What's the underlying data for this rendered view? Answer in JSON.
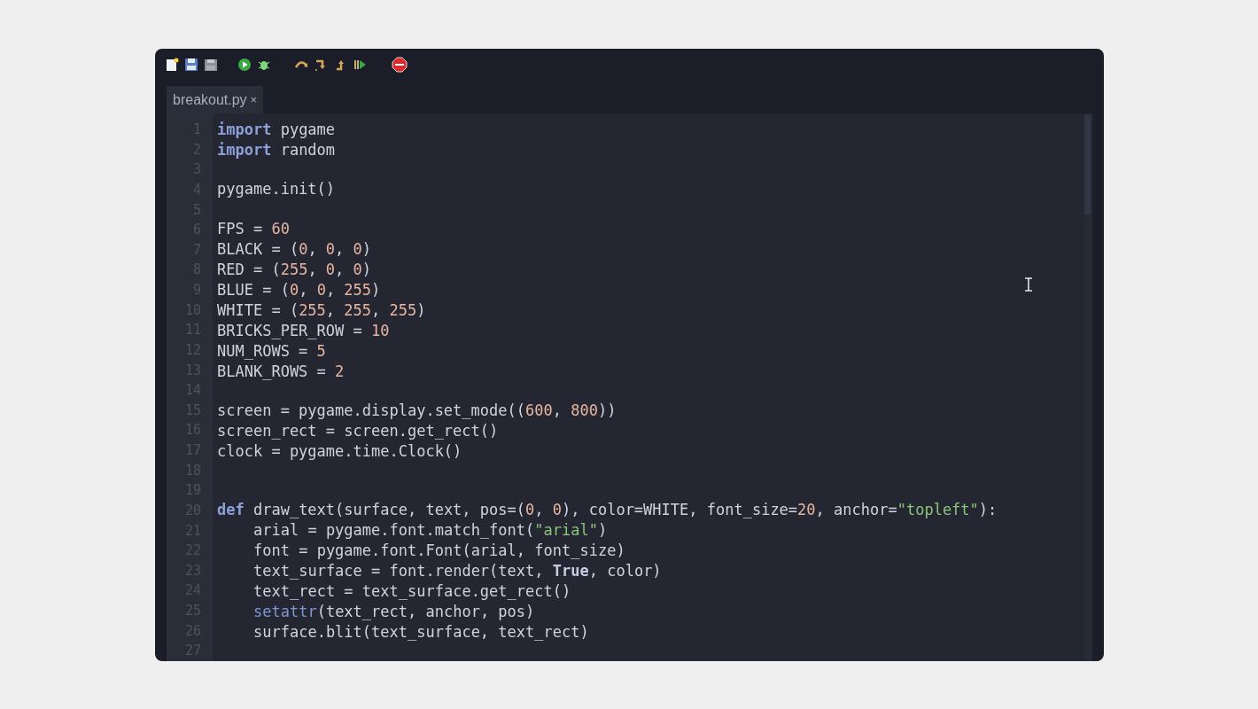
{
  "tabs": [
    {
      "label": "breakout.py",
      "close": "×",
      "selected": true
    }
  ],
  "editor": {
    "lines": [
      {
        "number": "1",
        "tokens": [
          {
            "kind": "keyword",
            "text": "import"
          },
          {
            "kind": "plain",
            "text": " pygame"
          }
        ]
      },
      {
        "number": "2",
        "tokens": [
          {
            "kind": "keyword",
            "text": "import"
          },
          {
            "kind": "plain",
            "text": " random"
          }
        ]
      },
      {
        "number": "3"
      },
      {
        "number": "4",
        "tokens": [
          {
            "kind": "plain",
            "text": "pygame.init()"
          }
        ]
      },
      {
        "number": "5"
      },
      {
        "number": "6",
        "tokens": [
          {
            "kind": "plain",
            "text": "FPS = "
          },
          {
            "kind": "number",
            "text": "60"
          }
        ]
      },
      {
        "number": "7",
        "tokens": [
          {
            "kind": "plain",
            "text": "BLACK = ("
          },
          {
            "kind": "number",
            "text": "0"
          },
          {
            "kind": "plain",
            "text": ", "
          },
          {
            "kind": "number",
            "text": "0"
          },
          {
            "kind": "plain",
            "text": ", "
          },
          {
            "kind": "number",
            "text": "0"
          },
          {
            "kind": "plain",
            "text": ")"
          }
        ]
      },
      {
        "number": "8",
        "tokens": [
          {
            "kind": "plain",
            "text": "RED = ("
          },
          {
            "kind": "number",
            "text": "255"
          },
          {
            "kind": "plain",
            "text": ", "
          },
          {
            "kind": "number",
            "text": "0"
          },
          {
            "kind": "plain",
            "text": ", "
          },
          {
            "kind": "number",
            "text": "0"
          },
          {
            "kind": "plain",
            "text": ")"
          }
        ]
      },
      {
        "number": "9",
        "tokens": [
          {
            "kind": "plain",
            "text": "BLUE = ("
          },
          {
            "kind": "number",
            "text": "0"
          },
          {
            "kind": "plain",
            "text": ", "
          },
          {
            "kind": "number",
            "text": "0"
          },
          {
            "kind": "plain",
            "text": ", "
          },
          {
            "kind": "number",
            "text": "255"
          },
          {
            "kind": "plain",
            "text": ")"
          }
        ]
      },
      {
        "number": "10",
        "tokens": [
          {
            "kind": "plain",
            "text": "WHITE = ("
          },
          {
            "kind": "number",
            "text": "255"
          },
          {
            "kind": "plain",
            "text": ", "
          },
          {
            "kind": "number",
            "text": "255"
          },
          {
            "kind": "plain",
            "text": ", "
          },
          {
            "kind": "number",
            "text": "255"
          },
          {
            "kind": "plain",
            "text": ")"
          }
        ]
      },
      {
        "number": "11",
        "tokens": [
          {
            "kind": "plain",
            "text": "BRICKS_PER_ROW = "
          },
          {
            "kind": "number",
            "text": "10"
          }
        ]
      },
      {
        "number": "12",
        "tokens": [
          {
            "kind": "plain",
            "text": "NUM_ROWS = "
          },
          {
            "kind": "number",
            "text": "5"
          }
        ]
      },
      {
        "number": "13",
        "tokens": [
          {
            "kind": "plain",
            "text": "BLANK_ROWS = "
          },
          {
            "kind": "number",
            "text": "2"
          }
        ]
      },
      {
        "number": "14"
      },
      {
        "number": "15",
        "tokens": [
          {
            "kind": "plain",
            "text": "screen = pygame.display.set_mode(("
          },
          {
            "kind": "number",
            "text": "600"
          },
          {
            "kind": "plain",
            "text": ", "
          },
          {
            "kind": "number",
            "text": "800"
          },
          {
            "kind": "plain",
            "text": "))"
          }
        ]
      },
      {
        "number": "16",
        "tokens": [
          {
            "kind": "plain",
            "text": "screen_rect = screen.get_rect()"
          }
        ]
      },
      {
        "number": "17",
        "tokens": [
          {
            "kind": "plain",
            "text": "clock = pygame.time.Clock()"
          }
        ]
      },
      {
        "number": "18"
      },
      {
        "number": "19"
      },
      {
        "number": "20",
        "tokens": [
          {
            "kind": "keyword",
            "text": "def"
          },
          {
            "kind": "plain",
            "text": " draw_text(surface, text, pos=("
          },
          {
            "kind": "number",
            "text": "0"
          },
          {
            "kind": "plain",
            "text": ", "
          },
          {
            "kind": "number",
            "text": "0"
          },
          {
            "kind": "plain",
            "text": "), color=WHITE, font_size="
          },
          {
            "kind": "number",
            "text": "20"
          },
          {
            "kind": "plain",
            "text": ", anchor="
          },
          {
            "kind": "string",
            "text": "\"topleft\""
          },
          {
            "kind": "plain",
            "text": "):"
          }
        ]
      },
      {
        "number": "21",
        "indented": true,
        "tokens": [
          {
            "kind": "plain",
            "text": "arial = pygame.font.match_font("
          },
          {
            "kind": "string",
            "text": "\"arial\""
          },
          {
            "kind": "plain",
            "text": ")"
          }
        ]
      },
      {
        "number": "22",
        "indented": true,
        "tokens": [
          {
            "kind": "plain",
            "text": "font = pygame.font.Font(arial, font_size)"
          }
        ]
      },
      {
        "number": "23",
        "indented": true,
        "tokens": [
          {
            "kind": "plain",
            "text": "text_surface = font.render(text, "
          },
          {
            "kind": "constant",
            "text": "True"
          },
          {
            "kind": "plain",
            "text": ", color)"
          }
        ]
      },
      {
        "number": "24",
        "indented": true,
        "tokens": [
          {
            "kind": "plain",
            "text": "text_rect = text_surface.get_rect()"
          }
        ]
      },
      {
        "number": "25",
        "indented": true,
        "tokens": [
          {
            "kind": "builtin",
            "text": "setattr"
          },
          {
            "kind": "plain",
            "text": "(text_rect, anchor, pos)"
          }
        ]
      },
      {
        "number": "26",
        "indented": true,
        "tokens": [
          {
            "kind": "plain",
            "text": "surface.blit(text_surface, text_rect)"
          }
        ]
      },
      {
        "number": "27"
      }
    ]
  }
}
